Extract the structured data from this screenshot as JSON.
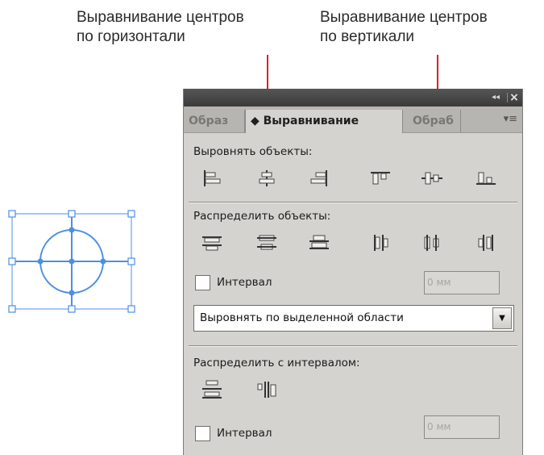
{
  "callouts": {
    "horizontal": {
      "line1": "Выравнивание центров",
      "line2": "по горизонтали"
    },
    "vertical": {
      "line1": "Выравнивание центров",
      "line2": "по вертикали"
    }
  },
  "panel": {
    "titlebar": {
      "collapse_icon": "◂◂",
      "close_icon": "×"
    },
    "tabs": [
      {
        "label": "Образ"
      },
      {
        "label": "◆ Выравнивание"
      },
      {
        "label": "Обраб"
      }
    ],
    "menu_icon": "▾≡",
    "align_objects": {
      "label": "Выровнять объекты:",
      "buttons": [
        "align-left-edges",
        "align-horizontal-centers",
        "align-right-edges",
        "align-top-edges",
        "align-vertical-centers",
        "align-bottom-edges"
      ]
    },
    "distribute_objects": {
      "label": "Распределить объекты:",
      "buttons": [
        "distribute-top-edges",
        "distribute-vertical-centers",
        "distribute-bottom-edges",
        "distribute-left-edges",
        "distribute-horizontal-centers",
        "distribute-right-edges"
      ],
      "spacing_label": "Интервал",
      "spacing_value": "0 мм"
    },
    "align_to": {
      "value": "Выровнять по выделенной области",
      "arrow": "▼"
    },
    "distribute_spacing": {
      "label": "Распределить с интервалом:",
      "spacing_label": "Интервал",
      "spacing_value": "0 мм"
    }
  },
  "colors": {
    "leader_line": "#d8202a",
    "selection": "#4a90e2",
    "panel_bg": "#d5d3cf"
  }
}
